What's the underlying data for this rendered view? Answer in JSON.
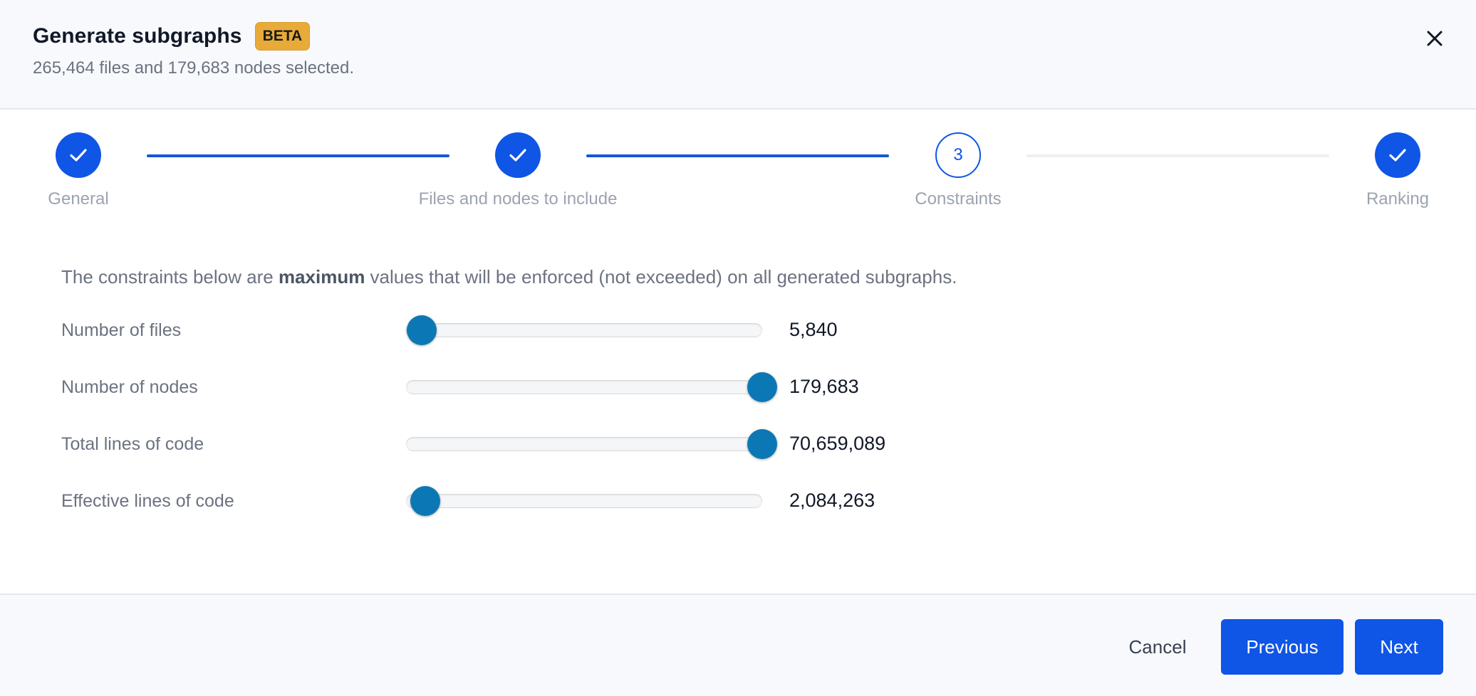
{
  "header": {
    "title": "Generate subgraphs",
    "badge": "BETA",
    "subtitle": "265,464 files and 179,683 nodes selected.",
    "close_icon": "close-icon"
  },
  "stepper": {
    "steps": [
      {
        "label": "General",
        "state": "done",
        "marker": ""
      },
      {
        "label": "Files and nodes to include",
        "state": "done",
        "marker": ""
      },
      {
        "label": "Constraints",
        "state": "current",
        "marker": "3"
      },
      {
        "label": "Ranking",
        "state": "done",
        "marker": ""
      }
    ]
  },
  "intro": {
    "prefix": "The constraints below are ",
    "bold": "maximum",
    "suffix": " values that will be enforced (not exceeded) on all generated subgraphs."
  },
  "constraints": [
    {
      "label": "Number of files",
      "value": "5,840",
      "level": 0.02
    },
    {
      "label": "Number of nodes",
      "value": "179,683",
      "level": 1.0
    },
    {
      "label": "Total lines of code",
      "value": "70,659,089",
      "level": 1.0
    },
    {
      "label": "Effective lines of code",
      "value": "2,084,263",
      "level": 0.03
    }
  ],
  "footer": {
    "cancel_label": "Cancel",
    "previous_label": "Previous",
    "next_label": "Next"
  },
  "colors": {
    "primary": "#0f55e6",
    "slider_thumb": "#0b78b5",
    "beta_badge": "#e8ab3a"
  }
}
